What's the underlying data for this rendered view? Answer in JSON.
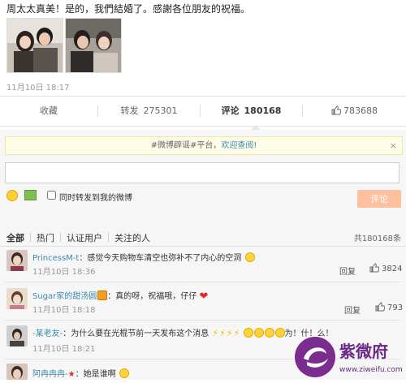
{
  "post": {
    "text": "周太太真美！是的，我們結婚了。感謝各位朋友的祝福。",
    "time": "11月10日 18:17"
  },
  "actions": {
    "favorite": "收藏",
    "repost_label": "转发",
    "repost_count": "275301",
    "comment_label": "评论",
    "comment_count": "180168",
    "like_count": "783688"
  },
  "tip": {
    "text": "#微博辟谣#平台，",
    "link": "欢迎查阅!",
    "close": "×"
  },
  "composer": {
    "input_value": "",
    "repost_label": "同时转发到我的微博",
    "submit_label": "评论"
  },
  "filter": {
    "tabs": [
      "全部",
      "热门",
      "认证用户",
      "关注的人"
    ],
    "active": "全部",
    "total": "共180168条"
  },
  "comments": [
    {
      "name": "PrincessM-t",
      "text": "：感觉今天购物车清空也弥补不了内心的空洞",
      "time": "11月10日 18:36",
      "reply": "回复",
      "likes": "3824"
    },
    {
      "name": "Sugar家的甜汤圆",
      "text": "：真的呀，祝福哦，仔仔",
      "time": "11月10日 18:18",
      "reply": "回复",
      "likes": "793"
    },
    {
      "name": "-某老友-",
      "text": "：为什么要在光棍节前一天发布这个消息",
      "suffix": "为！什！么！",
      "time": "11月10日 18:21"
    },
    {
      "name": "阿冉冉冉-",
      "text": "：她是谁啊"
    }
  ],
  "watermark": {
    "brand": "紫微府",
    "url": "www.ziweifu.com"
  },
  "colors": {
    "link": "#3b8ab0",
    "submit": "#ffc09f",
    "tip_bg": "#fefde8",
    "heart": "#e52b2b"
  },
  "icons": [
    "emoji-icon",
    "image-icon",
    "thumbs-up-icon",
    "close-icon",
    "heart-icon",
    "lightning-icon",
    "crying-face-icon",
    "star-icon"
  ]
}
